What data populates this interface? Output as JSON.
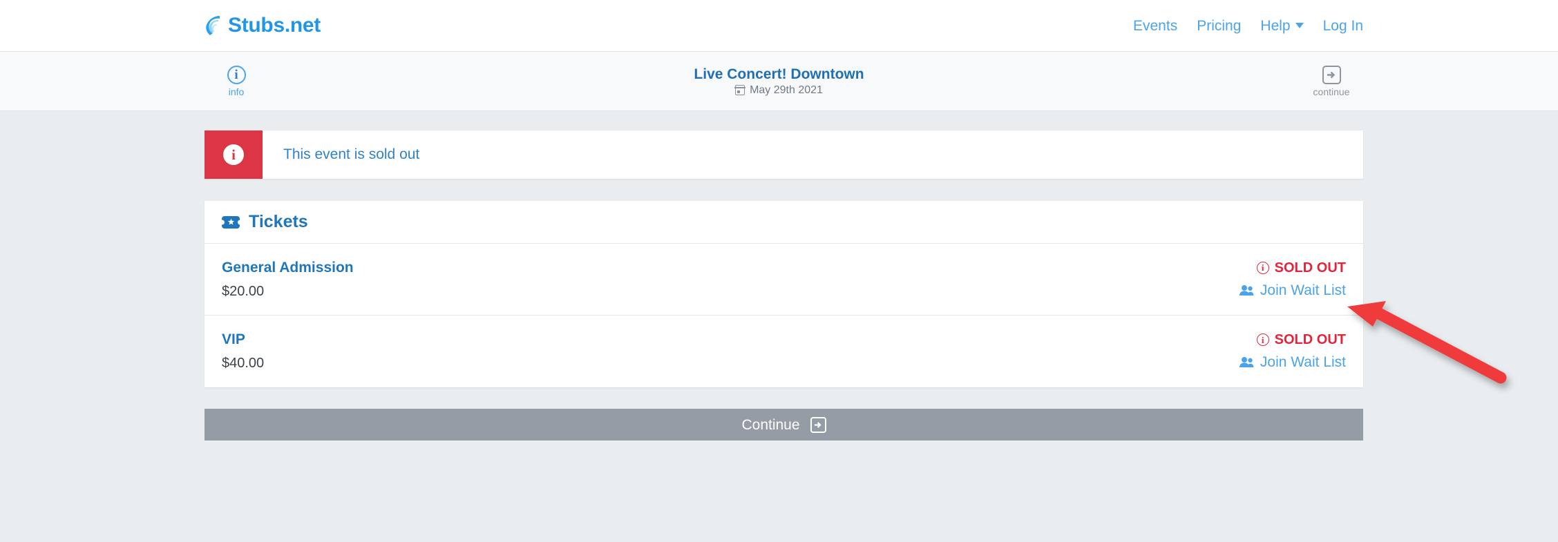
{
  "brand": {
    "name": "Stubs.net",
    "color": "#2196e8"
  },
  "nav": {
    "items": [
      {
        "label": "Events",
        "has_caret": false
      },
      {
        "label": "Pricing",
        "has_caret": false
      },
      {
        "label": "Help",
        "has_caret": true
      },
      {
        "label": "Log In",
        "has_caret": false
      }
    ]
  },
  "event_bar": {
    "info_label": "info",
    "title": "Live Concert! Downtown",
    "date": "May 29th 2021",
    "continue_label": "continue"
  },
  "alert": {
    "message": "This event is sold out",
    "icon": "info-icon",
    "bg_color": "#dc3545"
  },
  "tickets": {
    "heading": "Tickets",
    "rows": [
      {
        "name": "General Admission",
        "price": "$20.00",
        "status": "SOLD OUT",
        "action": "Join Wait List"
      },
      {
        "name": "VIP",
        "price": "$40.00",
        "status": "SOLD OUT",
        "action": "Join Wait List"
      }
    ],
    "status_color": "#e2253b",
    "link_color": "#4ba3ea"
  },
  "footer": {
    "continue_label": "Continue"
  },
  "annotation": {
    "color": "#ef3b3b",
    "points_at": "Join Wait List"
  }
}
